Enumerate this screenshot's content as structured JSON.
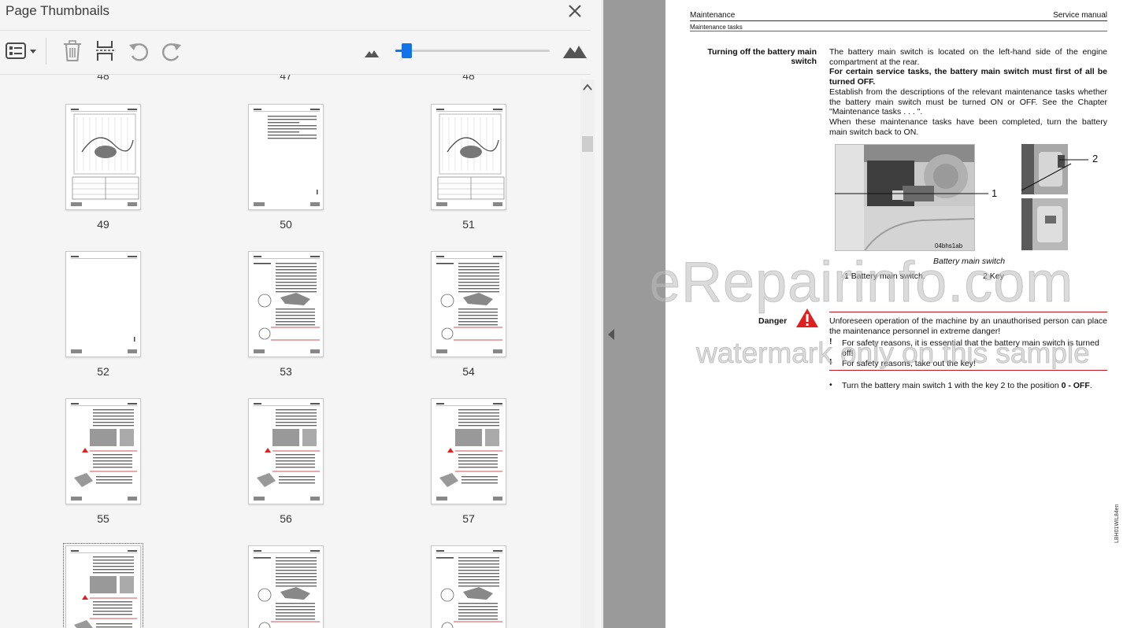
{
  "panel": {
    "title": "Page Thumbnails"
  },
  "toolbar": {
    "options_icon": "list-options-icon",
    "delete_icon": "trash-icon",
    "insert_icon": "insert-pages-icon",
    "undo_icon": "rotate-left-icon",
    "redo_icon": "rotate-right-icon",
    "zoom_out_icon": "small-mountain-icon",
    "zoom_in_icon": "large-mountain-icon",
    "zoom_level_fraction": 0.05
  },
  "thumbnails": {
    "top_partial": [
      "48",
      "47",
      "48"
    ],
    "pages": [
      {
        "label": "49",
        "kind": "diagram"
      },
      {
        "label": "50",
        "kind": "sparse"
      },
      {
        "label": "51",
        "kind": "diagram"
      },
      {
        "label": "52",
        "kind": "blank"
      },
      {
        "label": "53",
        "kind": "text-figures"
      },
      {
        "label": "54",
        "kind": "text-figures"
      },
      {
        "label": "55",
        "kind": "text-photo"
      },
      {
        "label": "56",
        "kind": "text-photo"
      },
      {
        "label": "57",
        "kind": "text-photo"
      },
      {
        "label": "",
        "kind": "text-photo",
        "current": true
      },
      {
        "label": "",
        "kind": "text-figures"
      },
      {
        "label": "",
        "kind": "text-figures"
      }
    ]
  },
  "document": {
    "header_left": "Maintenance",
    "header_right": "Service manual",
    "header_sub": "Maintenance tasks",
    "section_heading_1": "Turning off the battery main",
    "section_heading_2": "switch",
    "para1": [
      "The battery main switch is located on the left-hand side of the engine",
      "compartment at the rear."
    ],
    "para2_bold": [
      "For certain service tasks, the battery main switch must first of all be",
      "turned OFF."
    ],
    "para3": [
      "Establish from the descriptions of the relevant maintenance tasks whether",
      "the battery main switch must be turned ON or OFF. See the Chapter",
      "\"Maintenance tasks . . . \"."
    ],
    "para4": [
      "When these maintenance tasks have been completed, turn the battery",
      "main switch back to ON."
    ],
    "figure": {
      "callout_1": "1",
      "callout_2": "2",
      "image_code": "04bhs1ab",
      "caption": "Battery main switch",
      "legend_1": "1  Battery main switch.",
      "legend_2": "2  Key"
    },
    "danger_label": "Danger",
    "danger_text": [
      "Unforeseen operation of the machine by an unauthorised person can place",
      "the maintenance personnel in extreme danger!"
    ],
    "safety_1": [
      "For safety reasons, it is essential that the battery main switch is turned",
      "off!"
    ],
    "safety_2": "For safety reasons, take out the key!",
    "exclaim": "!",
    "bullet_symbol": "•",
    "bullet_pre": "Turn the battery main switch 1 with the key 2 to the position ",
    "bullet_bold": "0 - OFF",
    "bullet_post": ".",
    "side_code": "LBH01WIL84en"
  },
  "watermark": {
    "line1": "eRepairinfo.com",
    "line2": "watermark only on this sample"
  },
  "colors": {
    "accent": "#1473e6",
    "danger": "#e02020",
    "rule_red": "#c0151b"
  }
}
